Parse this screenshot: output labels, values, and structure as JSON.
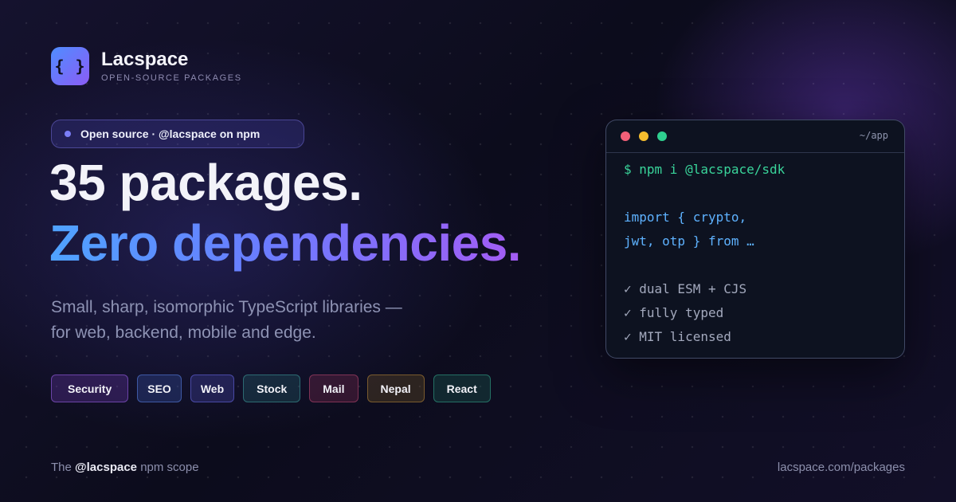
{
  "brand": {
    "logo_glyph": "{ }",
    "name": "Lacspace",
    "tagline": "OPEN-SOURCE PACKAGES"
  },
  "badge": {
    "text": "Open source · @lacspace on npm"
  },
  "headline": {
    "line1": "35 packages.",
    "line2": "Zero dependencies."
  },
  "subtitle": {
    "line1": "Small, sharp, isomorphic TypeScript libraries —",
    "line2": "for web, backend, mobile and edge."
  },
  "tags": [
    {
      "label": "Security",
      "color": "#8b5cf6"
    },
    {
      "label": "SEO",
      "color": "#4f7fdc"
    },
    {
      "label": "Web",
      "color": "#6366f1"
    },
    {
      "label": "Stock",
      "color": "#3c9696"
    },
    {
      "label": "Mail",
      "color": "#b4466e"
    },
    {
      "label": "Nepal",
      "color": "#af8237"
    },
    {
      "label": "React",
      "color": "#32a087"
    }
  ],
  "footer": {
    "prefix": "The ",
    "scope": "@lacspace",
    "suffix": " npm scope",
    "url": "lacspace.com/packages"
  },
  "terminal": {
    "path": "~/app",
    "lines": [
      "$ npm i @lacspace/sdk",
      "",
      "import { crypto,",
      "jwt, otp } from …",
      "",
      "✓ dual ESM + CJS",
      "✓ fully typed",
      "✓ MIT licensed"
    ]
  },
  "colors": {
    "accent_blue": "#4fa3ff",
    "accent_purple": "#a45cf4",
    "terminal_command": "#39d49a",
    "terminal_code": "#5eb2ff"
  }
}
